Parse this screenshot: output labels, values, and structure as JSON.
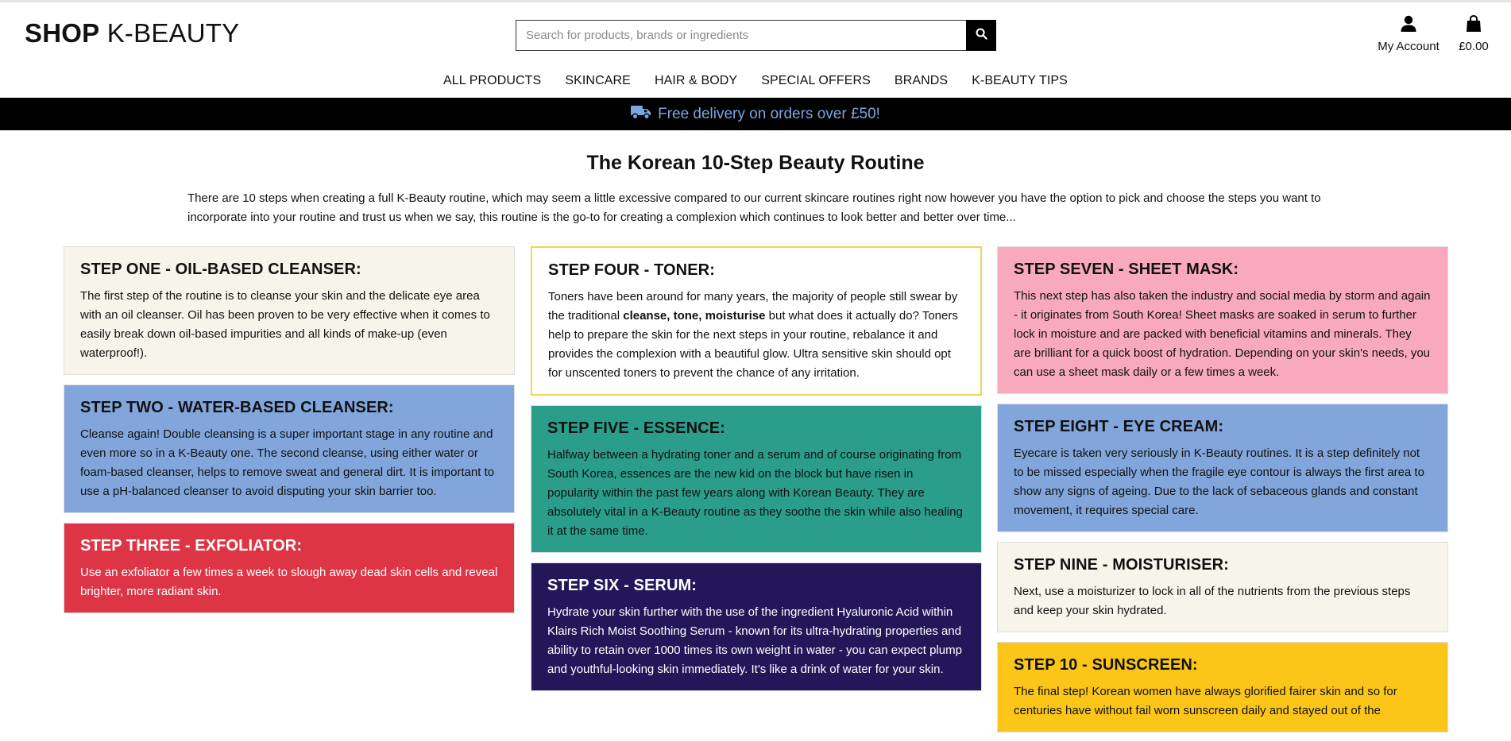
{
  "header": {
    "logo_bold": "SHOP",
    "logo_rest": "K-BEAUTY",
    "search_placeholder": "Search for products, brands or ingredients",
    "account_label": "My Account",
    "bag_total": "£0.00"
  },
  "nav": [
    "ALL PRODUCTS",
    "SKINCARE",
    "HAIR & BODY",
    "SPECIAL OFFERS",
    "BRANDS",
    "K-BEAUTY TIPS"
  ],
  "banner": {
    "text": "Free delivery on orders over £50!"
  },
  "main": {
    "title": "The Korean 10-Step Beauty Routine",
    "intro": "There are 10 steps when creating a full K-Beauty routine, which may seem a little excessive compared to our current skincare routines right now however you have the option to pick and choose the steps you want to incorporate into your routine and trust us when we say, this routine is the go-to for creating a complexion which continues to look better and better over time..."
  },
  "steps": {
    "s1": {
      "title": "STEP ONE - OIL-BASED CLEANSER:",
      "text": "The first step of the routine is to cleanse your skin and the delicate eye area with an oil cleanser. Oil has been proven to be very effective when it comes to easily break down oil-based impurities and all kinds of make-up (even waterproof!)."
    },
    "s2": {
      "title": "STEP TWO - WATER-BASED CLEANSER:",
      "text": "Cleanse again! Double cleansing is a super important stage in any routine and even more so in a K-Beauty one. The second cleanse, using either water or foam-based cleanser, helps to remove sweat and general dirt. It is important to use a pH-balanced cleanser to avoid disputing your skin barrier too."
    },
    "s3": {
      "title": "STEP THREE - EXFOLIATOR:",
      "text": "Use an exfoliator a few times a week to slough away dead skin cells and reveal brighter, more radiant skin."
    },
    "s4": {
      "title": "STEP FOUR - TONER:",
      "text_a": "Toners have been around for many years, the majority of people still swear by the traditional ",
      "text_bold": "cleanse, tone, moisturise",
      "text_b": " but what does it actually do? Toners help to prepare the skin for the next steps in your routine, rebalance it and provides the complexion with a beautiful glow. Ultra sensitive skin should opt for unscented toners to prevent the chance of any irritation."
    },
    "s5": {
      "title": "STEP FIVE - ESSENCE:",
      "text": "Halfway between a hydrating toner and a serum and of course originating from South Korea, essences are the new kid on the block but have risen in popularity within the past few years along with Korean Beauty. They are absolutely vital in a K-Beauty routine as they soothe the skin while also healing it at the same time."
    },
    "s6": {
      "title": "STEP SIX - SERUM:",
      "text": "Hydrate your skin further with the use of the ingredient Hyaluronic Acid within Klairs Rich Moist Soothing Serum - known for its ultra-hydrating properties and ability to retain over 1000 times its own weight in water - you can expect plump and youthful-looking skin immediately. It's like a drink of water for your skin."
    },
    "s7": {
      "title": "STEP SEVEN - SHEET MASK:",
      "text": "This next step has also taken the industry and social media by storm and again - it originates from South Korea! Sheet masks are soaked in serum to further lock in moisture and are packed with beneficial vitamins and minerals. They are brilliant for a quick boost of hydration. Depending on your skin's needs, you can use a sheet mask daily or a few times a week."
    },
    "s8": {
      "title": "STEP EIGHT - EYE CREAM:",
      "text": "Eyecare is taken very seriously in K-Beauty routines. It is a step definitely not to be missed especially when the fragile eye contour is always the first area to show any signs of ageing. Due to the lack of sebaceous glands and constant movement, it requires special care."
    },
    "s9": {
      "title": "STEP NINE - MOISTURISER:",
      "text": "Next, use a moisturizer to lock in all of the nutrients from the previous steps and keep your skin hydrated."
    },
    "s10": {
      "title": "STEP 10 - SUNSCREEN:",
      "text": "The final step! Korean women have always glorified fairer skin and so for centuries have without fail worn sunscreen daily and stayed out of the"
    }
  },
  "icons": {
    "search": "search-icon",
    "account": "user-icon",
    "bag": "shopping-bag-icon",
    "banner": "truck-icon"
  },
  "colors": {
    "banner_bg": "#000000",
    "banner_text": "#7aa5e0",
    "cream": "#f7f4e9",
    "blue": "#82a6db",
    "red": "#dd3546",
    "teal": "#2a9d8b",
    "navy": "#23175a",
    "pink": "#f8a9be",
    "yellow": "#fbc618",
    "toner_border": "#f5d451"
  }
}
